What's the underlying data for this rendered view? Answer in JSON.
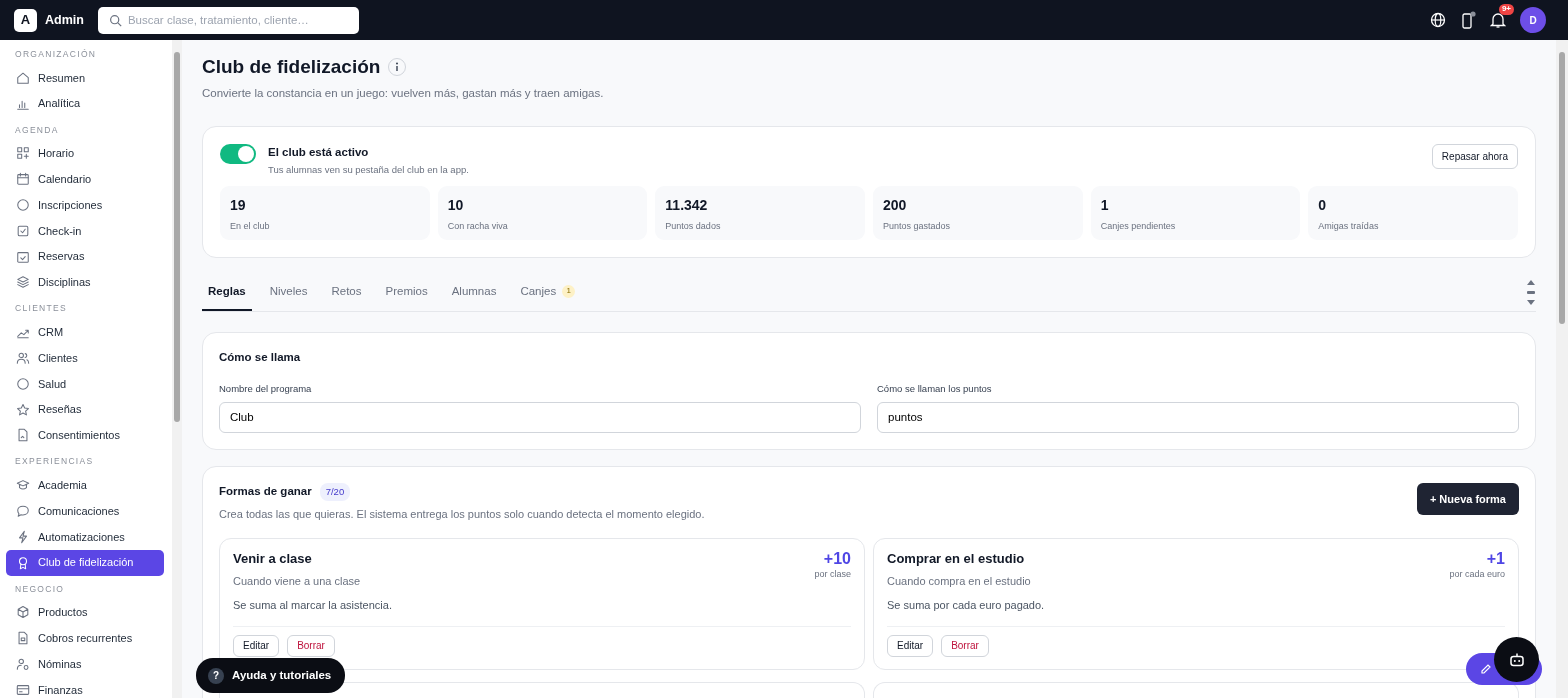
{
  "topbar": {
    "logo": "A",
    "brand": "Admin",
    "search": {
      "placeholder": "Buscar clase, tratamiento, cliente…"
    },
    "notifications": "9+",
    "avatar": "D"
  },
  "sidebar": {
    "sections": [
      {
        "title": "ORGANIZACIÓN",
        "items": [
          {
            "label": "Resumen",
            "selected": false
          },
          {
            "label": "Analítica",
            "selected": false
          }
        ]
      },
      {
        "title": "AGENDA",
        "items": [
          {
            "label": "Horario",
            "selected": false
          },
          {
            "label": "Calendario",
            "selected": false
          },
          {
            "label": "Inscripciones",
            "selected": false
          },
          {
            "label": "Check-in",
            "selected": false
          },
          {
            "label": "Reservas",
            "selected": false
          },
          {
            "label": "Disciplinas",
            "selected": false
          }
        ]
      },
      {
        "title": "CLIENTES",
        "items": [
          {
            "label": "CRM",
            "selected": false
          },
          {
            "label": "Clientes",
            "selected": false
          },
          {
            "label": "Salud",
            "selected": false
          },
          {
            "label": "Reseñas",
            "selected": false
          },
          {
            "label": "Consentimientos",
            "selected": false
          }
        ]
      },
      {
        "title": "EXPERIENCIAS",
        "items": [
          {
            "label": "Academia",
            "selected": false
          },
          {
            "label": "Comunicaciones",
            "selected": false
          },
          {
            "label": "Automatizaciones",
            "selected": false
          },
          {
            "label": "Club de fidelización",
            "selected": true
          }
        ]
      },
      {
        "title": "NEGOCIO",
        "items": [
          {
            "label": "Productos",
            "selected": false
          },
          {
            "label": "Cobros recurrentes",
            "selected": false
          },
          {
            "label": "Nóminas",
            "selected": false
          },
          {
            "label": "Finanzas",
            "selected": false
          }
        ]
      }
    ]
  },
  "page": {
    "title": "Club de fidelización",
    "subtitle": "Convierte la constancia en un juego: vuelven más, gastan más y traen amigas."
  },
  "club": {
    "active": true,
    "title": "El club está activo",
    "subtitle": "Tus alumnas ven su pestaña del club en la app.",
    "button": "Repasar ahora",
    "stats": [
      {
        "value": "19",
        "label": "En el club"
      },
      {
        "value": "10",
        "label": "Con racha viva"
      },
      {
        "value": "11.342",
        "label": "Puntos dados"
      },
      {
        "value": "200",
        "label": "Puntos gastados"
      },
      {
        "value": "1",
        "label": "Canjes pendientes"
      },
      {
        "value": "0",
        "label": "Amigas traídas"
      }
    ]
  },
  "tabs": [
    {
      "label": "Reglas",
      "selected": true
    },
    {
      "label": "Niveles",
      "selected": false
    },
    {
      "label": "Retos",
      "selected": false
    },
    {
      "label": "Premios",
      "selected": false
    },
    {
      "label": "Alumnas",
      "selected": false
    },
    {
      "label": "Canjes",
      "selected": false,
      "badge": "1"
    }
  ],
  "naming": {
    "title": "Cómo se llama",
    "fields": [
      {
        "label": "Nombre del programa",
        "value": "Club"
      },
      {
        "label": "Cómo se llaman los puntos",
        "value": "puntos"
      }
    ]
  },
  "earn": {
    "title": "Formas de ganar",
    "count": "7/20",
    "description": "Crea todas las que quieras. El sistema entrega los puntos solo cuando detecta el momento elegido.",
    "button": "+ Nueva forma",
    "rules": [
      {
        "title": "Venir a clase",
        "trigger": "Cuando viene a una clase",
        "points": "+10",
        "unit": "por clase",
        "note": "Se suma al marcar la asistencia.",
        "edit": "Editar",
        "delete": "Borrar"
      },
      {
        "title": "Comprar en el estudio",
        "trigger": "Cuando compra en el estudio",
        "points": "+1",
        "unit": "por cada euro",
        "note": "Se suma por cada euro pagado.",
        "edit": "Editar",
        "delete": "Borrar"
      }
    ]
  },
  "help": {
    "icon": "?",
    "label": "Ayuda y tutoriales"
  }
}
